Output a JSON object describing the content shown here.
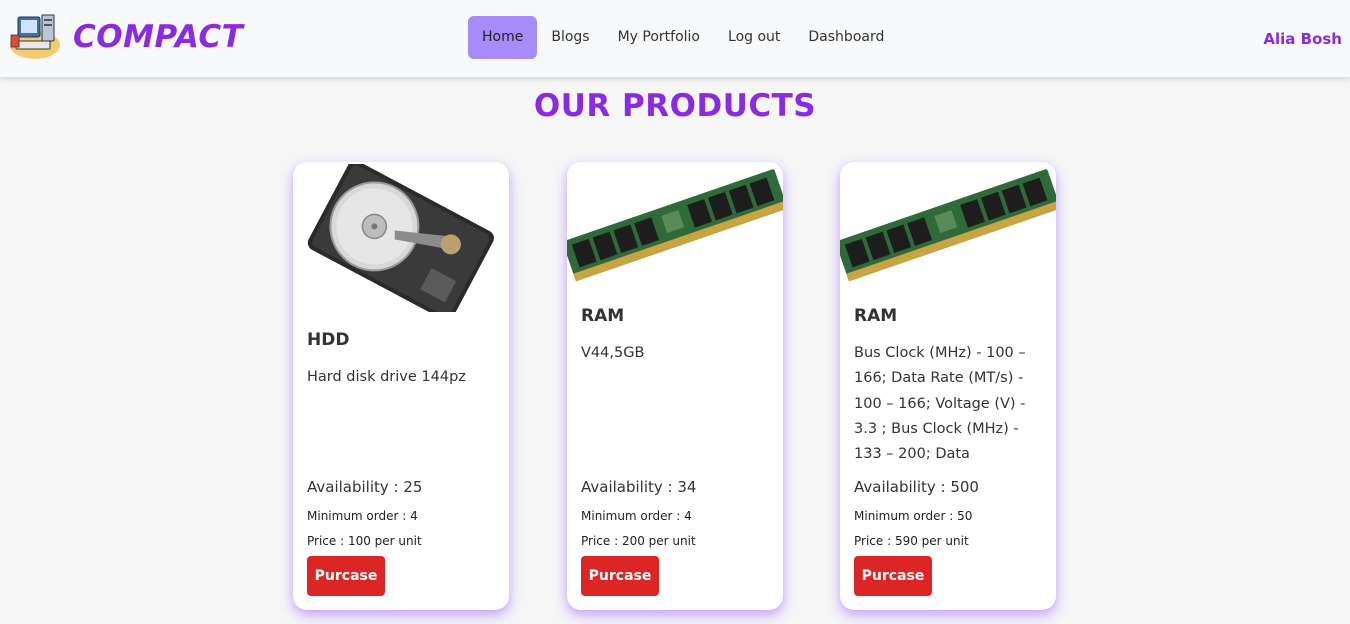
{
  "navbar": {
    "brand": "COMPACT",
    "links": [
      {
        "label": "Home"
      },
      {
        "label": "Blogs"
      },
      {
        "label": "My Portfolio"
      },
      {
        "label": "Log out"
      },
      {
        "label": "Dashboard"
      }
    ],
    "active_link": "Home",
    "user_name": "Alia Bosh"
  },
  "page": {
    "title": "OUR PRODUCTS"
  },
  "products": [
    {
      "image": "hard-disk-drive-image",
      "name": "HDD",
      "description": "Hard disk drive 144pz",
      "availability": "Availability : 25",
      "min_order": "Minimum order : 4",
      "price": "Price : 100 per unit",
      "button": "Purcase"
    },
    {
      "image": "ram-module-image",
      "name": "RAM",
      "description": "V44,5GB",
      "availability": "Availability : 34",
      "min_order": "Minimum order : 4",
      "price": "Price : 200 per unit",
      "button": "Purcase"
    },
    {
      "image": "ram-module-image",
      "name": "RAM",
      "description": "Bus Clock (MHz) - 100 – 166; Data Rate (MT/s) - 100 – 166; Voltage (V) - 3.3 ; Bus Clock (MHz) - 133 – 200; Data",
      "availability": "Availability : 500",
      "min_order": "Minimum order : 50",
      "price": "Price : 590 per unit",
      "button": "Purcase"
    }
  ],
  "colors": {
    "brand": "#8a2be2",
    "active_nav": "#a78bfa",
    "button": "#dc2626",
    "card_glow": "#a76eff"
  }
}
